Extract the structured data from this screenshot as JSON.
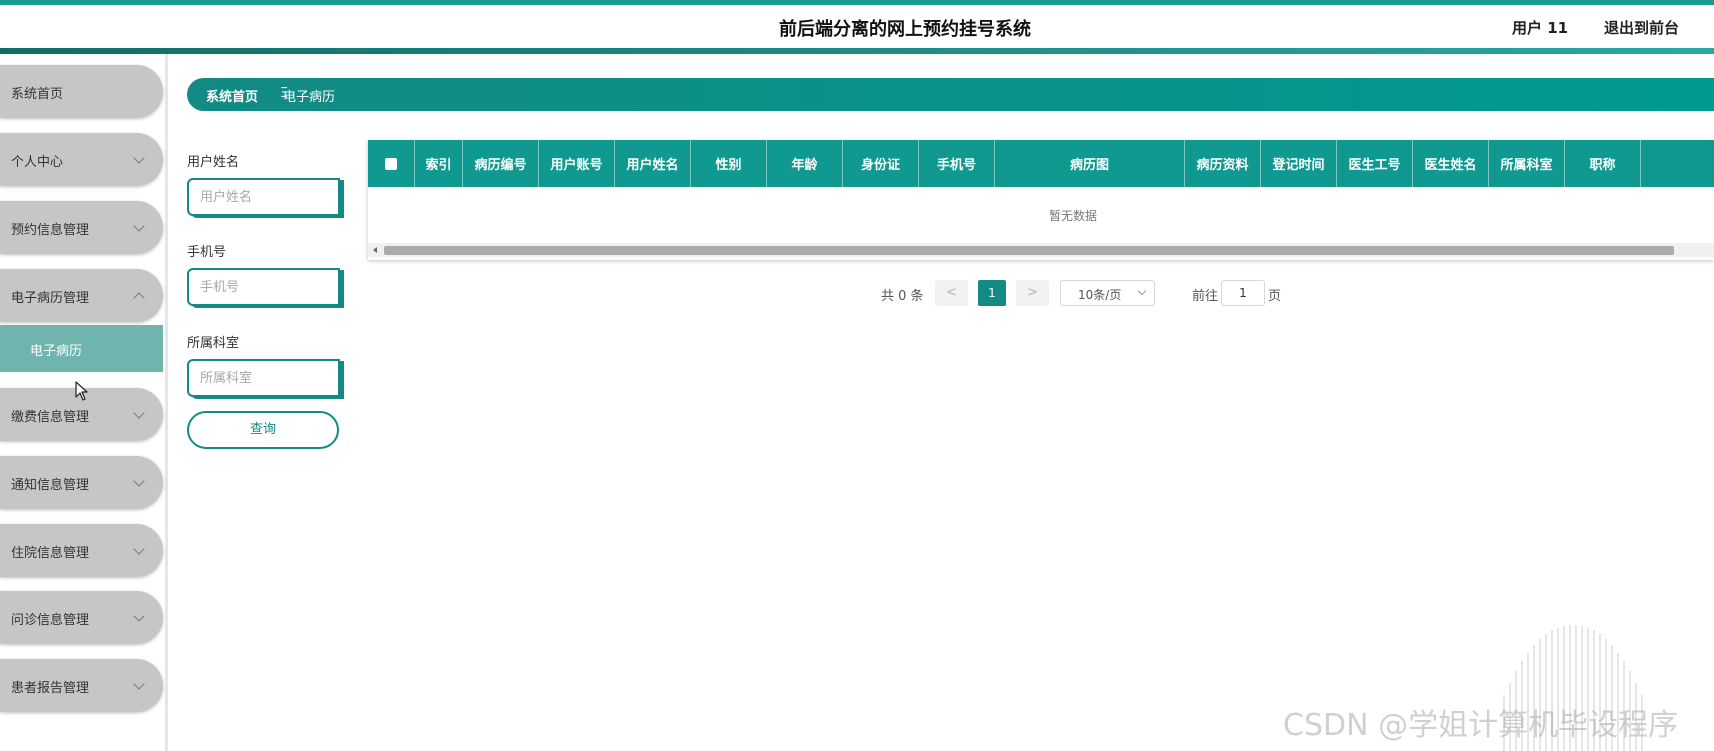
{
  "header": {
    "title": "前后端分离的网上预约挂号系统",
    "user_label": "用户 11",
    "exit_label": "退出到前台"
  },
  "sidebar": {
    "items": [
      {
        "label": "系统首页",
        "chevron": false
      },
      {
        "label": "个人中心",
        "chevron": "down"
      },
      {
        "label": "预约信息管理",
        "chevron": "down"
      },
      {
        "label": "电子病历管理",
        "chevron": "up",
        "expanded": true
      },
      {
        "label": "缴费信息管理",
        "chevron": "down"
      },
      {
        "label": "通知信息管理",
        "chevron": "down"
      },
      {
        "label": "住院信息管理",
        "chevron": "down"
      },
      {
        "label": "问诊信息管理",
        "chevron": "down"
      },
      {
        "label": "患者报告管理",
        "chevron": "down"
      }
    ],
    "active_subitem": "电子病历"
  },
  "breadcrumb": {
    "home": "系统首页",
    "separator": "Ξ",
    "current": "电子病历"
  },
  "search": {
    "fields": [
      {
        "label": "用户姓名",
        "placeholder": "用户姓名",
        "value": ""
      },
      {
        "label": "手机号",
        "placeholder": "手机号",
        "value": ""
      },
      {
        "label": "所属科室",
        "placeholder": "所属科室",
        "value": ""
      }
    ],
    "query_label": "查询"
  },
  "table": {
    "columns": [
      "索引",
      "病历编号",
      "用户账号",
      "用户姓名",
      "性别",
      "年龄",
      "身份证",
      "手机号",
      "病历图",
      "病历资料",
      "登记时间",
      "医生工号",
      "医生姓名",
      "所属科室",
      "职称"
    ],
    "rows": [],
    "empty_text": "暂无数据"
  },
  "pagination": {
    "total_text": "共 0 条",
    "prev": "<",
    "current_page": "1",
    "next": ">",
    "page_size": "10条/页",
    "goto_prefix": "前往",
    "goto_value": "1",
    "goto_suffix": "页"
  },
  "watermark": "CSDN @学姐计算机毕设程序",
  "colors": {
    "primary": "#138a83",
    "header_teal": "#0f9990",
    "sidebar_item": "#c6c6c6",
    "sidebar_active": "#6fb5ae"
  }
}
